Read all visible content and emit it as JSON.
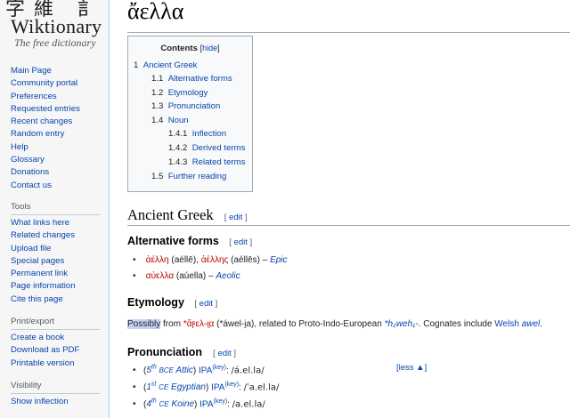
{
  "logo": {
    "glyphs": "字維 訁",
    "title": "Wiktionary",
    "subtitle": "The free dictionary"
  },
  "nav": {
    "main": [
      "Main Page",
      "Community portal",
      "Preferences",
      "Requested entries",
      "Recent changes",
      "Random entry",
      "Help",
      "Glossary",
      "Donations",
      "Contact us"
    ],
    "tools_heading": "Tools",
    "tools": [
      "What links here",
      "Related changes",
      "Upload file",
      "Special pages",
      "Permanent link",
      "Page information",
      "Cite this page"
    ],
    "print_heading": "Print/export",
    "print": [
      "Create a book",
      "Download as PDF",
      "Printable version"
    ],
    "visibility_heading": "Visibility",
    "visibility": [
      "Show inflection"
    ]
  },
  "page": {
    "title": "ἄελλα"
  },
  "toc": {
    "title": "Contents",
    "hide_label": "hide",
    "items": [
      {
        "num": "1",
        "label": "Ancient Greek"
      },
      {
        "num": "1.1",
        "label": "Alternative forms"
      },
      {
        "num": "1.2",
        "label": "Etymology"
      },
      {
        "num": "1.3",
        "label": "Pronunciation"
      },
      {
        "num": "1.4",
        "label": "Noun"
      },
      {
        "num": "1.4.1",
        "label": "Inflection"
      },
      {
        "num": "1.4.2",
        "label": "Derived terms"
      },
      {
        "num": "1.4.3",
        "label": "Related terms"
      },
      {
        "num": "1.5",
        "label": "Further reading"
      }
    ]
  },
  "sections": {
    "edit_label": "edit",
    "ancient_greek": "Ancient Greek",
    "alt_forms": "Alternative forms",
    "etymology": "Etymology",
    "pronunciation": "Pronunciation"
  },
  "alt_forms": {
    "line1": {
      "w1": "ἀέλλη",
      "t1": "(aéllē)",
      "w2": "ἀέλλης",
      "t2": "(aéllēs)",
      "dash": "–",
      "lang": "Epic"
    },
    "line2": {
      "w1": "αὐελλα",
      "t1": "(aúella)",
      "dash": "–",
      "lang": "Aeolic"
    }
  },
  "etymology": {
    "possibly": "Possibly",
    "from": "from",
    "star_word": "*ἄϝελ-ι̯α",
    "star_translit": "(*áwel-i̯a)",
    "related": ", related to Proto-Indo-European",
    "pie_root": "*h₂weh₁-",
    "cognates": ". Cognates include",
    "welsh": "Welsh",
    "awel": "awel",
    "end": "."
  },
  "pronunciation": {
    "less": "[less ▲]",
    "lines": [
      {
        "open": "(",
        "sup": "th",
        "num": "5",
        "era": "BCE",
        "dialect": "Attic",
        "close": ")",
        "ipa_label": "IPA",
        "key": "(key)",
        "colon": ":",
        "ipa": "/á.el.la/"
      },
      {
        "open": "(",
        "sup": "st",
        "num": "1",
        "era": "CE",
        "dialect": "Egyptian",
        "close": ")",
        "ipa_label": "IPA",
        "key": "(key)",
        "colon": ":",
        "ipa": "/ˈa.el.la/"
      },
      {
        "open": "(",
        "sup": "th",
        "num": "4",
        "era": "CE",
        "dialect": "Koine",
        "close": ")",
        "ipa_label": "IPA",
        "key": "(key)",
        "colon": ":",
        "ipa": "/a.el.la/"
      }
    ]
  }
}
